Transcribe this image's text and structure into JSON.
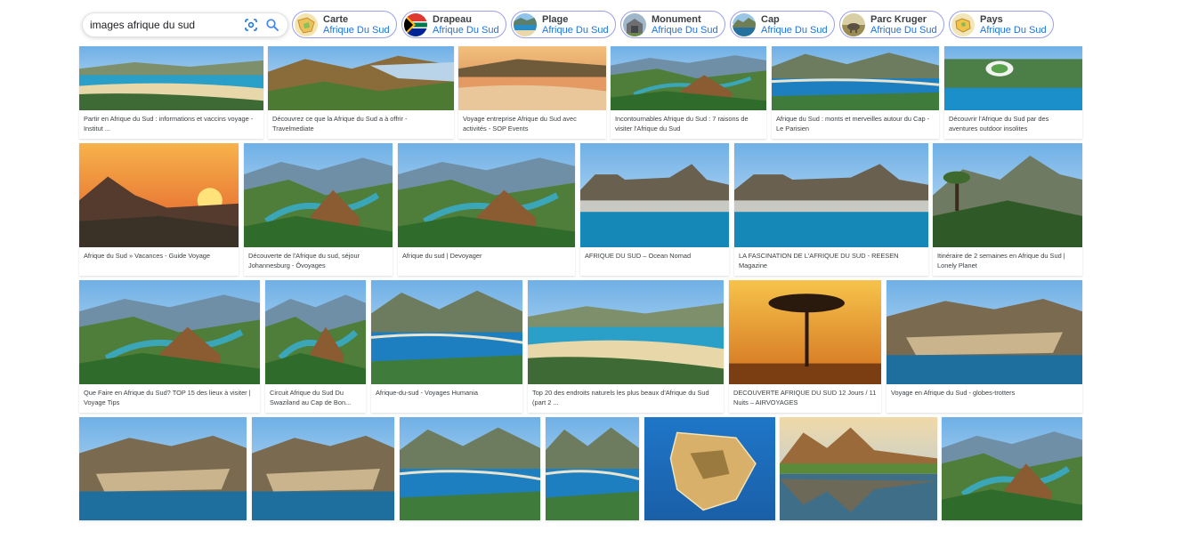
{
  "search": {
    "query": "images afrique du sud"
  },
  "chips": [
    {
      "title": "Carte",
      "subtitle": "Afrique Du Sud",
      "icon": "map-thumbnail"
    },
    {
      "title": "Drapeau",
      "subtitle": "Afrique Du Sud",
      "icon": "flag-thumbnail"
    },
    {
      "title": "Plage",
      "subtitle": "Afrique Du Sud",
      "icon": "beach-thumbnail"
    },
    {
      "title": "Monument",
      "subtitle": "Afrique Du Sud",
      "icon": "monument-thumbnail"
    },
    {
      "title": "Cap",
      "subtitle": "Afrique Du Sud",
      "icon": "cape-thumbnail"
    },
    {
      "title": "Parc Kruger",
      "subtitle": "Afrique Du Sud",
      "icon": "kruger-thumbnail"
    },
    {
      "title": "Pays",
      "subtitle": "Afrique Du Sud",
      "icon": "country-thumbnail"
    }
  ],
  "results": [
    [
      {
        "caption": "Partir en Afrique du Sud : informations et vaccins voyage - Institut ...",
        "scene": "coast"
      },
      {
        "caption": "Découvrez ce que la Afrique du Sud a à offrir - Travelmediate",
        "scene": "cliffs"
      },
      {
        "caption": "Voyage entreprise Afrique du Sud avec activités - SOP Events",
        "scene": "sunset-beach"
      },
      {
        "caption": "Incontournables Afrique du Sud : 7 raisons de visiter l'Afrique du Sud",
        "scene": "canyon"
      },
      {
        "caption": "Afrique du Sud : monts et merveilles autour du Cap - Le Parisien",
        "scene": "bay"
      },
      {
        "caption": "Découvrir l'Afrique du Sud par des aventures outdoor insolites",
        "scene": "stadium"
      }
    ],
    [
      {
        "caption": "Afrique du Sud » Vacances - Guide Voyage",
        "scene": "sunset"
      },
      {
        "caption": "Découverte de l'Afrique du sud, séjour Johannesburg - Ôvoyages",
        "scene": "canyon"
      },
      {
        "caption": "Afrique du sud | Devoyager",
        "scene": "canyon"
      },
      {
        "caption": "AFRIQUE DU SUD – Ocean Nomad",
        "scene": "table-mountain"
      },
      {
        "caption": "LA FASCINATION DE L'AFRIQUE DU SUD - REESEN Magazine",
        "scene": "table-mountain"
      },
      {
        "caption": "Itinéraire de 2 semaines en Afrique du Sud | Lonely Planet",
        "scene": "lions-head"
      }
    ],
    [
      {
        "caption": "Que Faire en Afrique du Sud? TOP 15 des lieux à visiter | Voyage Tips",
        "scene": "canyon"
      },
      {
        "caption": "Circuit Afrique du Sud Du Swaziland au Cap de Bon...",
        "scene": "canyon"
      },
      {
        "caption": "Afrique-du-sud - Voyages Humania",
        "scene": "bay"
      },
      {
        "caption": "Top 20 des endroits naturels les plus beaux d'Afrique du Sud (part 2 ...",
        "scene": "coast"
      },
      {
        "caption": "DECOUVERTE AFRIQUE DU SUD 12 Jours / 11 Nuits – AIRVOYAGES",
        "scene": "savanna"
      },
      {
        "caption": "Voyage en Afrique du Sud - globes-trotters",
        "scene": "aerial-city"
      }
    ],
    [
      {
        "caption": "",
        "scene": "aerial-city"
      },
      {
        "caption": "",
        "scene": "aerial-city"
      },
      {
        "caption": "",
        "scene": "bay"
      },
      {
        "caption": "",
        "scene": "bay"
      },
      {
        "caption": "",
        "scene": "continent-map"
      },
      {
        "caption": "",
        "scene": "lake"
      },
      {
        "caption": "",
        "scene": "canyon"
      }
    ]
  ]
}
